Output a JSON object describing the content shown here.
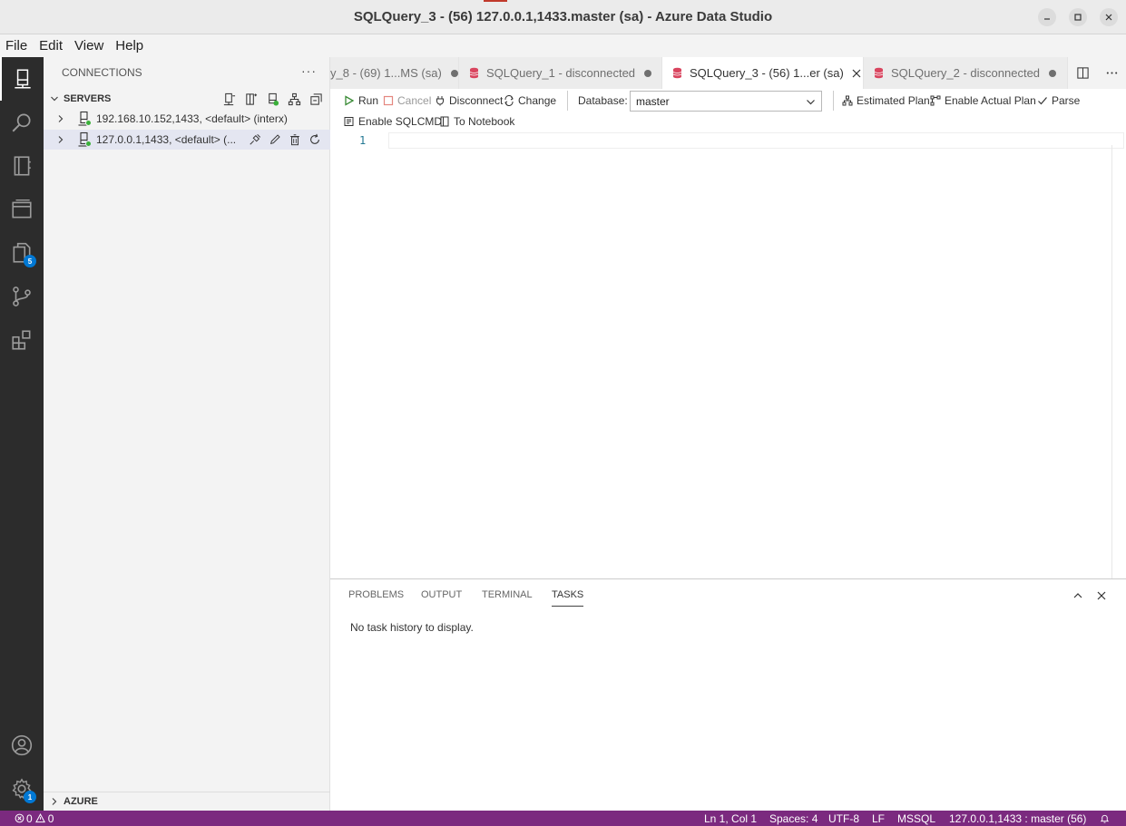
{
  "window": {
    "title": "SQLQuery_3 - (56) 127.0.0.1,1433.master (sa) - Azure Data Studio"
  },
  "menu": [
    "File",
    "Edit",
    "View",
    "Help"
  ],
  "activity_bar": {
    "items": [
      "connections-icon",
      "search-icon",
      "notebooks-icon",
      "explorer-icon",
      "copy-icon",
      "source-control-icon",
      "extensions-icon"
    ],
    "badges": {
      "copy": "5",
      "settings": "1"
    },
    "bottom": [
      "account-icon",
      "settings-icon"
    ]
  },
  "sidebar": {
    "header": "CONNECTIONS",
    "more": "···",
    "servers_label": "SERVERS",
    "servers": [
      {
        "label": "192.168.10.152,1433, <default> (interx)"
      },
      {
        "label": "127.0.0.1,1433, <default> (..."
      }
    ],
    "azure_label": "AZURE"
  },
  "tabs": [
    {
      "label": "y_8 - (69) 1...MS (sa)",
      "dirty": true
    },
    {
      "label": "SQLQuery_1 - disconnected",
      "dirty": true
    },
    {
      "label": "SQLQuery_3 - (56) 1...er (sa)",
      "active": true
    },
    {
      "label": "SQLQuery_2 - disconnected",
      "dirty": true
    }
  ],
  "toolbar": {
    "run": "Run",
    "cancel": "Cancel",
    "disconnect": "Disconnect",
    "change": "Change",
    "database_label": "Database:",
    "database_value": "master",
    "estimated_plan": "Estimated Plan",
    "enable_actual_plan": "Enable Actual Plan",
    "parse": "Parse",
    "enable_sqlcmd": "Enable SQLCMD",
    "to_notebook": "To Notebook"
  },
  "editor": {
    "line_numbers": [
      "1"
    ]
  },
  "panel": {
    "tabs": [
      "PROBLEMS",
      "OUTPUT",
      "TERMINAL",
      "TASKS"
    ],
    "active_tab": "TASKS",
    "message": "No task history to display."
  },
  "status": {
    "errors": "0",
    "warnings": "0",
    "position": "Ln 1, Col 1",
    "spaces": "Spaces: 4",
    "encoding": "UTF-8",
    "eol": "LF",
    "language": "MSSQL",
    "connection": "127.0.0.1,1433 : master (56)"
  },
  "colors": {
    "status_bar": "#7b2a7f",
    "activity_bar": "#2c2c2c",
    "badge": "#0078d4",
    "connected_dot": "#3bb03b",
    "db_icon": "#d9455f"
  }
}
